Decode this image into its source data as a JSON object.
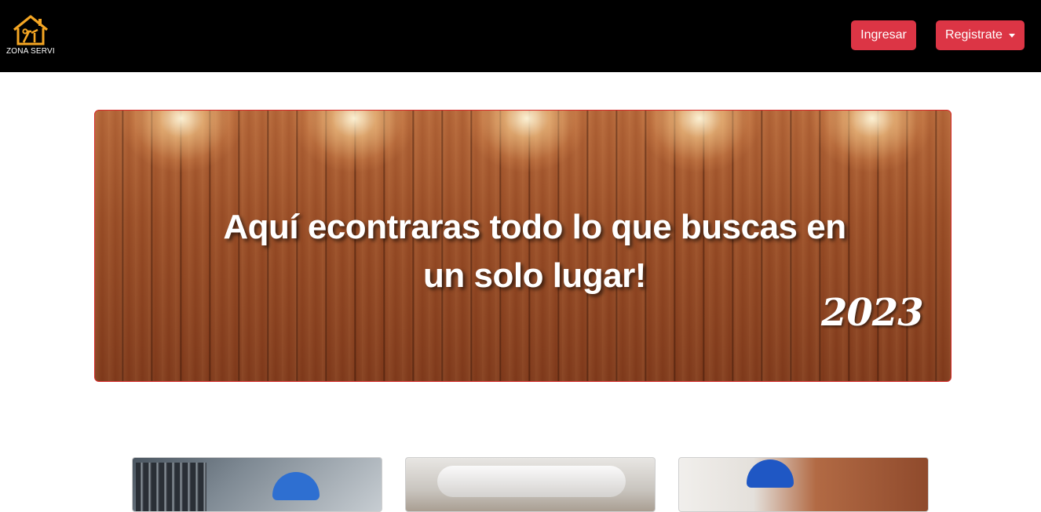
{
  "brand": {
    "name": "ZONA SERVI",
    "logo_icon": "house-tools-icon",
    "accent": "#f5a623"
  },
  "nav": {
    "login_label": "Ingresar",
    "register_label": "Registrate",
    "button_color": "#dc3545"
  },
  "banner": {
    "headline_line1": "Aquí econtraras todo lo que buscas en",
    "headline_line2": "un solo lugar!",
    "year": "2023",
    "border_color": "#d62828"
  },
  "cards": [
    {
      "image": "electrician-photo"
    },
    {
      "image": "plumber-photo"
    },
    {
      "image": "mason-photo"
    }
  ]
}
